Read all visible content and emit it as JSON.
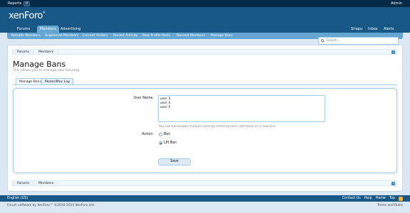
{
  "adminbar": {
    "reports_label": "Reports",
    "reports_count": "0",
    "admin_label": "Admin"
  },
  "header": {
    "logo_text": "xenForo",
    "logo_mark": "®"
  },
  "nav": {
    "tabs": [
      "Forums",
      "Members",
      "Advertising"
    ],
    "right": [
      "Sirapu",
      "Inbox",
      "Alerts"
    ],
    "sub": [
      "Notable Members",
      "Registered Members",
      "Current Visitors",
      "Recent Activity",
      "New Profile Posts",
      "Banned Members",
      "Manage Bans"
    ]
  },
  "search": {
    "placeholder": "Search..."
  },
  "breadcrumb": [
    "Forums",
    "Members"
  ],
  "page": {
    "title": "Manage Bans",
    "subtitle": "This allows you to manage user banning."
  },
  "content_tabs": [
    "Manage Bans",
    "ModeriMax Log"
  ],
  "form": {
    "user_name_label": "User Name:",
    "user_names": "user 3\nuser 4\nuser 5",
    "hint": "You can ban/unban multiple users by entering each username on a new line.",
    "action_label": "Action:",
    "options": [
      "Ban",
      "Lift Ban"
    ],
    "selected": "Lift Ban",
    "submit": "Save"
  },
  "footer": {
    "language": "English (US)",
    "links": [
      "Contact Us",
      "Help",
      "Home",
      "Top"
    ],
    "copyright": "Forum software by XenForo™ ©2010-2014 XenForo Ltd.",
    "terms": "Terms and Rules"
  }
}
